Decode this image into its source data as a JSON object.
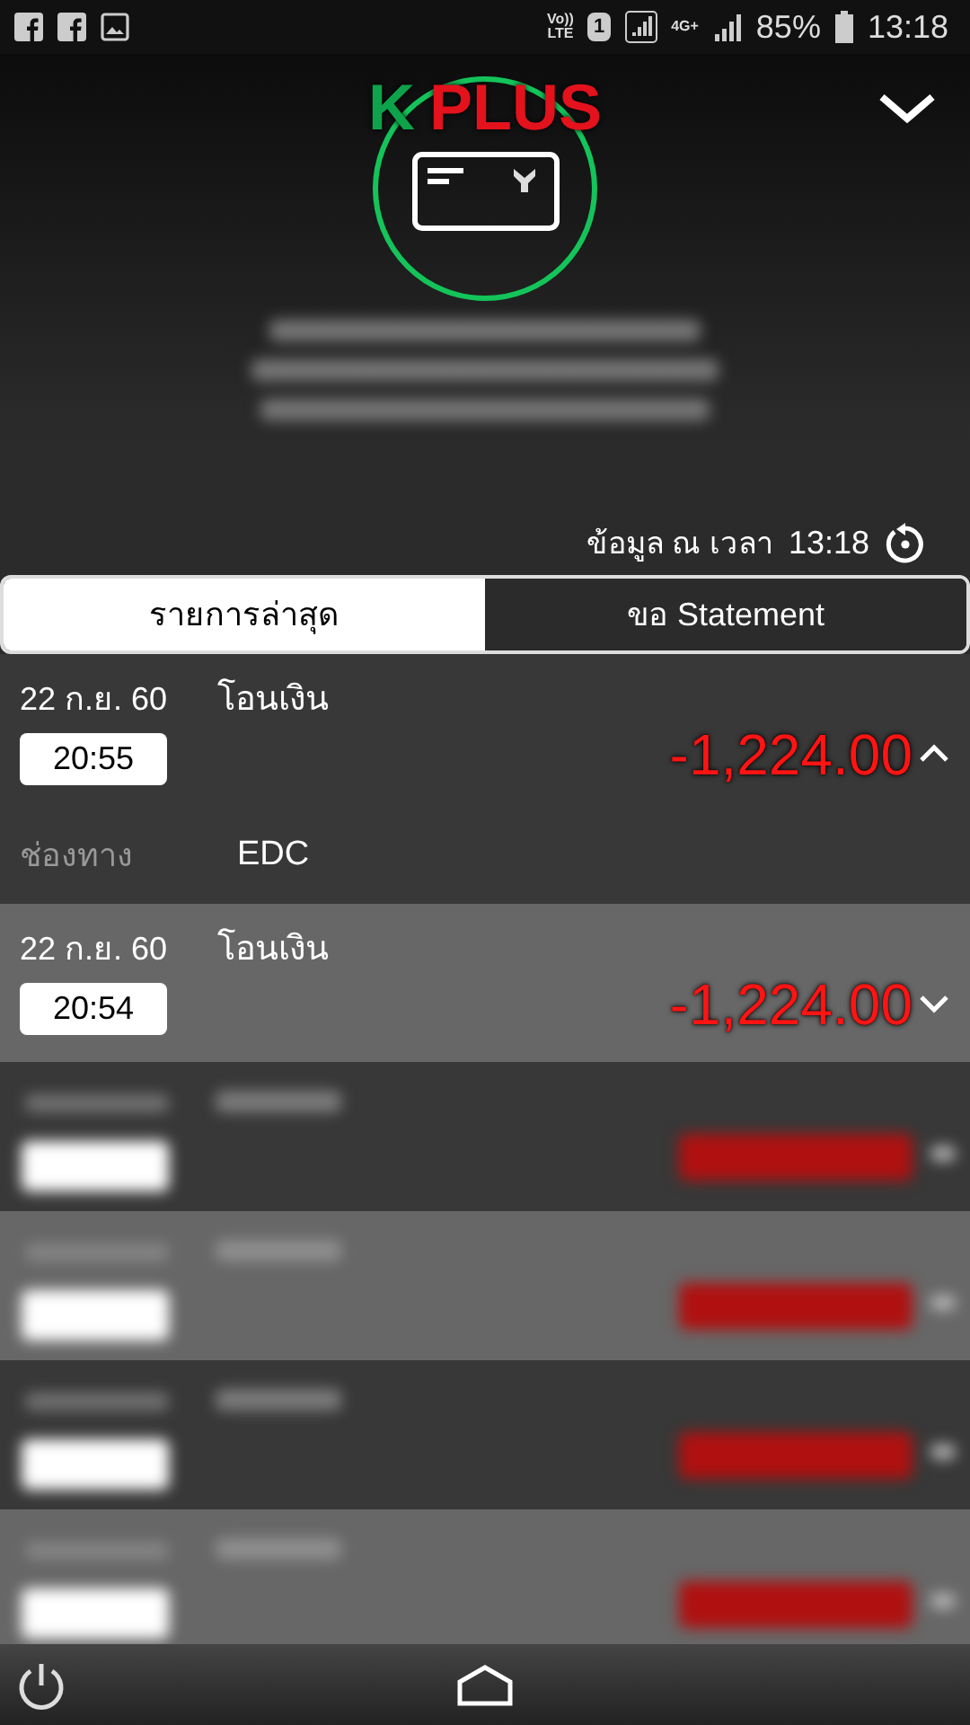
{
  "status_bar": {
    "volte": [
      "Vo))",
      "LTE"
    ],
    "sim": "1",
    "network": "4G+",
    "battery": "85%",
    "time": "13:18"
  },
  "header": {
    "logo": [
      {
        "text": "K",
        "color": "#0ea34a"
      },
      {
        "text": "PLUS",
        "color": "#e3121c"
      }
    ],
    "updated_label": "ข้อมูล ณ เวลา",
    "updated_time": "13:18"
  },
  "tabs": [
    {
      "label": "รายการล่าสุด",
      "selected": true
    },
    {
      "label": "ขอ Statement",
      "selected": false
    }
  ],
  "transactions": [
    {
      "kind": "entry",
      "date": "22 ก.ย. 60",
      "time": "20:55",
      "type": "โอนเงิน",
      "amount": "-1,224.00",
      "expanded": true,
      "details": [
        {
          "label": "ช่องทาง",
          "value": "EDC"
        }
      ]
    },
    {
      "kind": "entry",
      "date": "22 ก.ย. 60",
      "time": "20:54",
      "type": "โอนเงิน",
      "amount": "-1,224.00",
      "expanded": false
    },
    {
      "kind": "blurred"
    },
    {
      "kind": "blurred"
    },
    {
      "kind": "blurred"
    },
    {
      "kind": "blurred"
    }
  ]
}
